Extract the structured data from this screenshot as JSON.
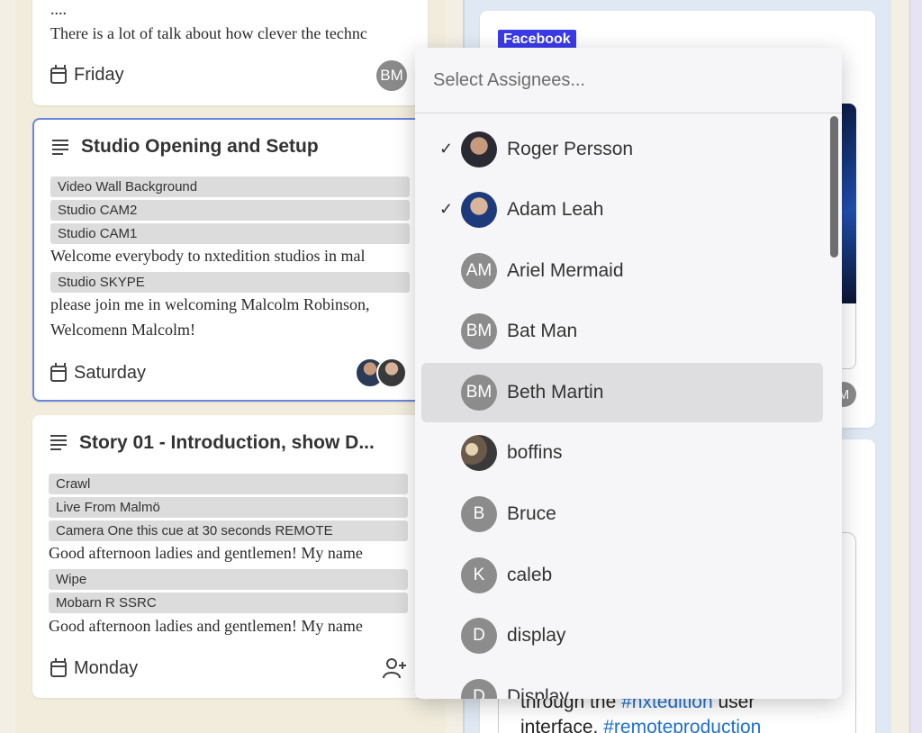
{
  "cards": {
    "top": {
      "ellipsis": "....",
      "snippet": "There is a lot of talk about how clever the technc",
      "day": "Friday",
      "assignee_initials": "BM"
    },
    "studio": {
      "title": "Studio Opening and Setup",
      "tags": [
        "Video Wall Background",
        "Studio CAM2",
        "Studio CAM1"
      ],
      "text1": "Welcome everybody to nxtedition studios in mal",
      "tag4": "Studio SKYPE",
      "text2": "please join me in welcoming Malcolm Robinson,",
      "text3": "Welcomenn Malcolm!",
      "day": "Saturday"
    },
    "story": {
      "title": "Story 01 - Introduction, show D...",
      "tags": [
        "Crawl",
        "Live From Malmö",
        "Camera One this cue at 30 seconds REMOTE"
      ],
      "text1": "Good afternoon ladies and gentlemen! My name",
      "tags2": [
        "Wipe",
        "Mobarn R SSRC"
      ],
      "text2": "Good afternoon ladies and gentlemen! My name",
      "day": "Monday"
    }
  },
  "right_column": {
    "badge": "Facebook",
    "partial_avatar_initial": "M",
    "bottom_text_prefix": "through the ",
    "bottom_hashtag1": "#nxtedition",
    "bottom_text_suffix": " user",
    "bottom_text2_prefix": "interface. ",
    "bottom_hashtag2": "#remoteproduction"
  },
  "dropdown": {
    "placeholder": "Select Assignees...",
    "check_glyph": "✓",
    "items": [
      {
        "name": "Roger Persson",
        "initials": "",
        "checked": true
      },
      {
        "name": "Adam Leah",
        "initials": "",
        "checked": true
      },
      {
        "name": "Ariel Mermaid",
        "initials": "AM",
        "checked": false
      },
      {
        "name": "Bat Man",
        "initials": "BM",
        "checked": false
      },
      {
        "name": "Beth Martin",
        "initials": "BM",
        "checked": false,
        "hovered": true
      },
      {
        "name": "boffins",
        "initials": "",
        "checked": false
      },
      {
        "name": "Bruce",
        "initials": "B",
        "checked": false
      },
      {
        "name": "caleb",
        "initials": "K",
        "checked": false
      },
      {
        "name": "display",
        "initials": "D",
        "checked": false
      },
      {
        "name": "Display",
        "initials": "D",
        "checked": false
      }
    ]
  },
  "colors": {
    "accent": "#6b86e0",
    "badge_bg": "#3a3ae8",
    "hashtag": "#1d6fd1"
  }
}
